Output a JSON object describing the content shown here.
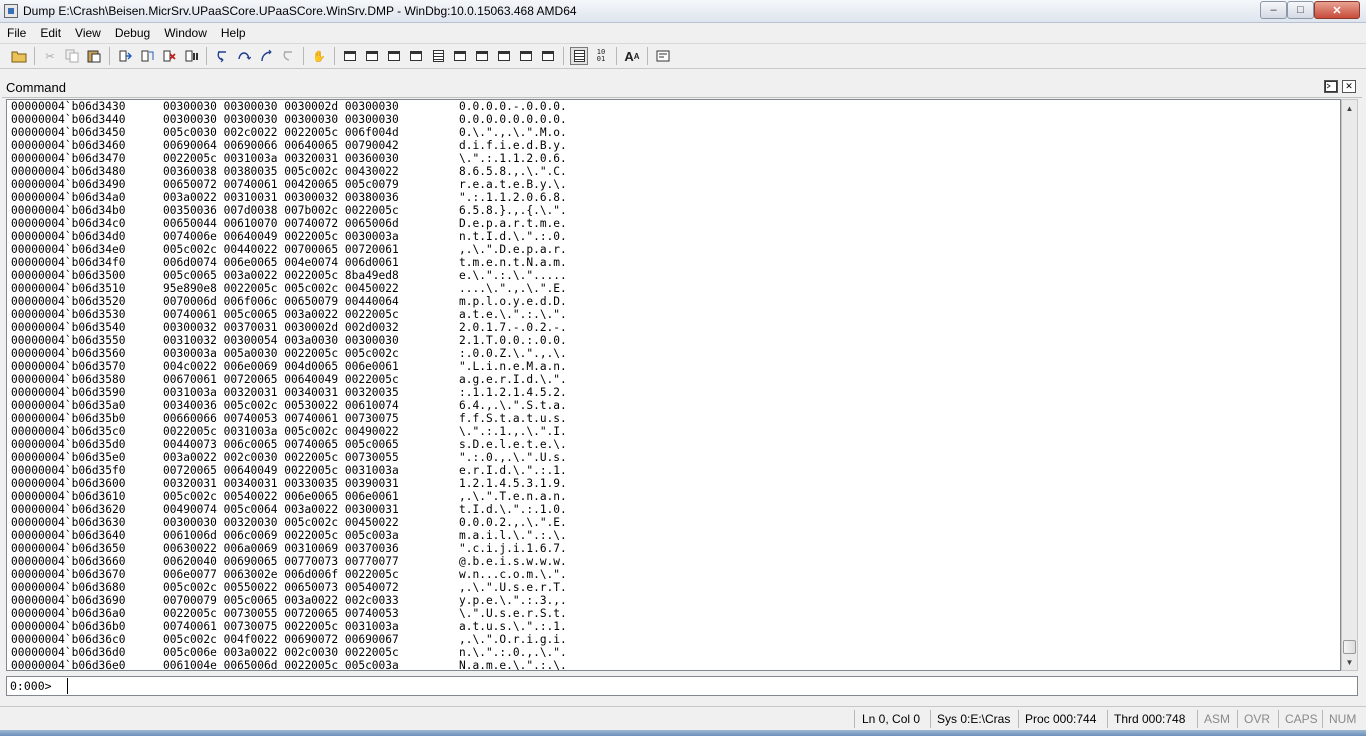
{
  "window": {
    "title": "Dump E:\\Crash\\Beisen.MicrSrv.UPaaSCore.UPaaSCore.WinSrv.DMP - WinDbg:10.0.15063.468 AMD64",
    "min_glyph": "–",
    "max_glyph": "□",
    "close_glyph": "✕"
  },
  "menu": [
    "File",
    "Edit",
    "View",
    "Debug",
    "Window",
    "Help"
  ],
  "toolbar": {
    "font_glyph": "A",
    "font_glyph_small": "A"
  },
  "command_window": {
    "title": "Command",
    "prompt": "0:000>",
    "input_value": ""
  },
  "memory_rows": [
    {
      "addr": "00000004`b06d3430",
      "hex": "00300030 00300030 0030002d 00300030",
      "ascii": "0.0.0.0.-.0.0.0."
    },
    {
      "addr": "00000004`b06d3440",
      "hex": "00300030 00300030 00300030 00300030",
      "ascii": "0.0.0.0.0.0.0.0."
    },
    {
      "addr": "00000004`b06d3450",
      "hex": "005c0030 002c0022 0022005c 006f004d",
      "ascii": "0.\\.\".,.\\.\".M.o."
    },
    {
      "addr": "00000004`b06d3460",
      "hex": "00690064 00690066 00640065 00790042",
      "ascii": "d.i.f.i.e.d.B.y."
    },
    {
      "addr": "00000004`b06d3470",
      "hex": "0022005c 0031003a 00320031 00360030",
      "ascii": "\\.\".:.1.1.2.0.6."
    },
    {
      "addr": "00000004`b06d3480",
      "hex": "00360038 00380035 005c002c 00430022",
      "ascii": "8.6.5.8.,.\\.\".C."
    },
    {
      "addr": "00000004`b06d3490",
      "hex": "00650072 00740061 00420065 005c0079",
      "ascii": "r.e.a.t.e.B.y.\\."
    },
    {
      "addr": "00000004`b06d34a0",
      "hex": "003a0022 00310031 00300032 00380036",
      "ascii": "\".:.1.1.2.0.6.8."
    },
    {
      "addr": "00000004`b06d34b0",
      "hex": "00350036 007d0038 007b002c 0022005c",
      "ascii": "6.5.8.}.,.{.\\.\"."
    },
    {
      "addr": "00000004`b06d34c0",
      "hex": "00650044 00610070 00740072 0065006d",
      "ascii": "D.e.p.a.r.t.m.e."
    },
    {
      "addr": "00000004`b06d34d0",
      "hex": "0074006e 00640049 0022005c 0030003a",
      "ascii": "n.t.I.d.\\.\".:.0."
    },
    {
      "addr": "00000004`b06d34e0",
      "hex": "005c002c 00440022 00700065 00720061",
      "ascii": ",.\\.\".D.e.p.a.r."
    },
    {
      "addr": "00000004`b06d34f0",
      "hex": "006d0074 006e0065 004e0074 006d0061",
      "ascii": "t.m.e.n.t.N.a.m."
    },
    {
      "addr": "00000004`b06d3500",
      "hex": "005c0065 003a0022 0022005c 8ba49ed8",
      "ascii": "e.\\.\".:.\\.\"....."
    },
    {
      "addr": "00000004`b06d3510",
      "hex": "95e890e8 0022005c 005c002c 00450022",
      "ascii": "....\\.\".,.\\.\".E."
    },
    {
      "addr": "00000004`b06d3520",
      "hex": "0070006d 006f006c 00650079 00440064",
      "ascii": "m.p.l.o.y.e.d.D."
    },
    {
      "addr": "00000004`b06d3530",
      "hex": "00740061 005c0065 003a0022 0022005c",
      "ascii": "a.t.e.\\.\".:.\\.\"."
    },
    {
      "addr": "00000004`b06d3540",
      "hex": "00300032 00370031 0030002d 002d0032",
      "ascii": "2.0.1.7.-.0.2.-."
    },
    {
      "addr": "00000004`b06d3550",
      "hex": "00310032 00300054 003a0030 00300030",
      "ascii": "2.1.T.0.0.:.0.0."
    },
    {
      "addr": "00000004`b06d3560",
      "hex": "0030003a 005a0030 0022005c 005c002c",
      "ascii": ":.0.0.Z.\\.\".,.\\."
    },
    {
      "addr": "00000004`b06d3570",
      "hex": "004c0022 006e0069 004d0065 006e0061",
      "ascii": "\".L.i.n.e.M.a.n."
    },
    {
      "addr": "00000004`b06d3580",
      "hex": "00670061 00720065 00640049 0022005c",
      "ascii": "a.g.e.r.I.d.\\.\"."
    },
    {
      "addr": "00000004`b06d3590",
      "hex": "0031003a 00320031 00340031 00320035",
      "ascii": ":.1.1.2.1.4.5.2."
    },
    {
      "addr": "00000004`b06d35a0",
      "hex": "00340036 005c002c 00530022 00610074",
      "ascii": "6.4.,.\\.\".S.t.a."
    },
    {
      "addr": "00000004`b06d35b0",
      "hex": "00660066 00740053 00740061 00730075",
      "ascii": "f.f.S.t.a.t.u.s."
    },
    {
      "addr": "00000004`b06d35c0",
      "hex": "0022005c 0031003a 005c002c 00490022",
      "ascii": "\\.\".:.1.,.\\.\".I."
    },
    {
      "addr": "00000004`b06d35d0",
      "hex": "00440073 006c0065 00740065 005c0065",
      "ascii": "s.D.e.l.e.t.e.\\."
    },
    {
      "addr": "00000004`b06d35e0",
      "hex": "003a0022 002c0030 0022005c 00730055",
      "ascii": "\".:.0.,.\\.\".U.s."
    },
    {
      "addr": "00000004`b06d35f0",
      "hex": "00720065 00640049 0022005c 0031003a",
      "ascii": "e.r.I.d.\\.\".:.1."
    },
    {
      "addr": "00000004`b06d3600",
      "hex": "00320031 00340031 00330035 00390031",
      "ascii": "1.2.1.4.5.3.1.9."
    },
    {
      "addr": "00000004`b06d3610",
      "hex": "005c002c 00540022 006e0065 006e0061",
      "ascii": ",.\\.\".T.e.n.a.n."
    },
    {
      "addr": "00000004`b06d3620",
      "hex": "00490074 005c0064 003a0022 00300031",
      "ascii": "t.I.d.\\.\".:.1.0."
    },
    {
      "addr": "00000004`b06d3630",
      "hex": "00300030 00320030 005c002c 00450022",
      "ascii": "0.0.0.2.,.\\.\".E."
    },
    {
      "addr": "00000004`b06d3640",
      "hex": "0061006d 006c0069 0022005c 005c003a",
      "ascii": "m.a.i.l.\\.\".:.\\."
    },
    {
      "addr": "00000004`b06d3650",
      "hex": "00630022 006a0069 00310069 00370036",
      "ascii": "\".c.i.j.i.1.6.7."
    },
    {
      "addr": "00000004`b06d3660",
      "hex": "00620040 00690065 00770073 00770077",
      "ascii": "@.b.e.i.s.w.w.w."
    },
    {
      "addr": "00000004`b06d3670",
      "hex": "006e0077 0063002e 006d006f 0022005c",
      "ascii": "w.n...c.o.m.\\.\"."
    },
    {
      "addr": "00000004`b06d3680",
      "hex": "005c002c 00550022 00650073 00540072",
      "ascii": ",.\\.\".U.s.e.r.T."
    },
    {
      "addr": "00000004`b06d3690",
      "hex": "00700079 005c0065 003a0022 002c0033",
      "ascii": "y.p.e.\\.\".:.3.,."
    },
    {
      "addr": "00000004`b06d36a0",
      "hex": "0022005c 00730055 00720065 00740053",
      "ascii": "\\.\".U.s.e.r.S.t."
    },
    {
      "addr": "00000004`b06d36b0",
      "hex": "00740061 00730075 0022005c 0031003a",
      "ascii": "a.t.u.s.\\.\".:.1."
    },
    {
      "addr": "00000004`b06d36c0",
      "hex": "005c002c 004f0022 00690072 00690067",
      "ascii": ",.\\.\".O.r.i.g.i."
    },
    {
      "addr": "00000004`b06d36d0",
      "hex": "005c006e 003a0022 002c0030 0022005c",
      "ascii": "n.\\.\".:.0.,.\\.\"."
    },
    {
      "addr": "00000004`b06d36e0",
      "hex": "0061004e 0065006d 0022005c 005c003a",
      "ascii": "N.a.m.e.\\.\".:.\\."
    }
  ],
  "statusbar": {
    "position": "Ln 0, Col 0",
    "sys": "Sys 0:E:\\Cras",
    "proc": "Proc 000:744",
    "thrd": "Thrd 000:748",
    "asm": "ASM",
    "ovr": "OVR",
    "caps": "CAPS",
    "num": "NUM"
  }
}
